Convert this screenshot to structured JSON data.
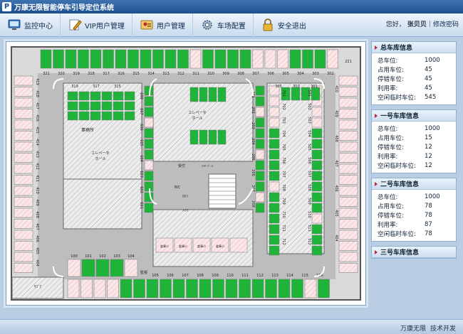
{
  "app": {
    "title": "万康无限智能停车引导定位系统",
    "logo": "P"
  },
  "toolbar": {
    "items": [
      {
        "label": "监控中心",
        "icon": "monitor-icon"
      },
      {
        "label": "VIP用户管理",
        "icon": "pen-icon"
      },
      {
        "label": "用户管理",
        "icon": "users-icon"
      },
      {
        "label": "车场配置",
        "icon": "gear-icon"
      },
      {
        "label": "安全退出",
        "icon": "lock-icon"
      }
    ]
  },
  "user": {
    "greeting": "您好，",
    "name": "张贝贝",
    "sep": "|",
    "change_password": "修改密码"
  },
  "map": {
    "row_top_left": [
      "321",
      "320",
      "319",
      "318",
      "317",
      "316",
      "315",
      "314",
      "313",
      "312",
      "311",
      "310",
      "309",
      "308",
      "307",
      "306",
      "305",
      "304",
      "303",
      "302"
    ],
    "row_top_right": "221",
    "block_top_labels": [
      "319",
      "317",
      "315",
      "305",
      "303",
      "301"
    ],
    "col_left_labels": [
      "419",
      "418",
      "417",
      "416",
      "415",
      "414",
      "413",
      "412",
      "411",
      "410",
      "409",
      "408",
      "407",
      "406",
      "405",
      "404"
    ],
    "col_inner_left": [
      "608",
      "607",
      "606",
      "605",
      "604",
      "603",
      "602",
      "601"
    ],
    "col_inner_right": [
      "201",
      "202",
      "203",
      "204",
      "205",
      "206",
      "207",
      "208"
    ],
    "col_right_a": [
      "701",
      "702",
      "703",
      "704",
      "705",
      "706",
      "707",
      "708",
      "709",
      "710",
      "711",
      "712"
    ],
    "col_right_b": [
      "501",
      "502",
      "503",
      "504",
      "505",
      "506",
      "507",
      "508",
      "509",
      "510",
      "511",
      "512"
    ],
    "col_far_right": [
      "410",
      "409",
      "408",
      "407",
      "406",
      "405",
      "404"
    ],
    "bottom_left": [
      "100",
      "101",
      "102",
      "103",
      "104"
    ],
    "bottom_row": [
      "105",
      "106",
      "107",
      "108",
      "109",
      "110",
      "111",
      "112",
      "113",
      "114",
      "115",
      "116"
    ],
    "labels": {
      "office": "事務所",
      "elevator1": "エレベータ",
      "hall1": "ホール",
      "elevator2": "エレベータ",
      "hall2": "ホール",
      "reception": "受付",
      "waiting": "ﾊｲﾔｰﾌﾟｰﾙ",
      "wc": "WC",
      "exit_gate": "出口",
      "entrance_gate": "入口",
      "gate_a": "精算機(出口)",
      "gate_b": "精算機(入口)",
      "monitor": "監視",
      "nav": "ｻﾌﾞｱ",
      "storage1": "倉庫小",
      "storage2": "倉庫小",
      "storage3": "倉庫小",
      "storage4": "倉庫小"
    }
  },
  "panels": [
    {
      "title": "总车库信息",
      "rows": [
        [
          "总车位:",
          "1000"
        ],
        [
          "占用车位:",
          "45"
        ],
        [
          "停错车位:",
          "45"
        ],
        [
          "利用率:",
          "45"
        ],
        [
          "空闲临时车位:",
          "545"
        ]
      ]
    },
    {
      "title": "一号车库信息",
      "rows": [
        [
          "总车位:",
          "1000"
        ],
        [
          "占用车位:",
          "15"
        ],
        [
          "停错车位:",
          "12"
        ],
        [
          "利用率:",
          "12"
        ],
        [
          "空闲临时车位:",
          "12"
        ]
      ]
    },
    {
      "title": "二号车库信息",
      "rows": [
        [
          "总车位:",
          "1000"
        ],
        [
          "占用车位:",
          "78"
        ],
        [
          "停错车位:",
          "78"
        ],
        [
          "利用率:",
          "87"
        ],
        [
          "空闲临时车位:",
          "78"
        ]
      ]
    },
    {
      "title": "三号车库信息",
      "rows": []
    }
  ],
  "footer": {
    "left": "万康无限",
    "right": "技术开发"
  },
  "colors": {
    "occupied": "#20b33a",
    "free": "#f7d6d8",
    "hatch": "#c9c9c9",
    "road": "#b8b8b8",
    "accent": "#c0282d"
  }
}
